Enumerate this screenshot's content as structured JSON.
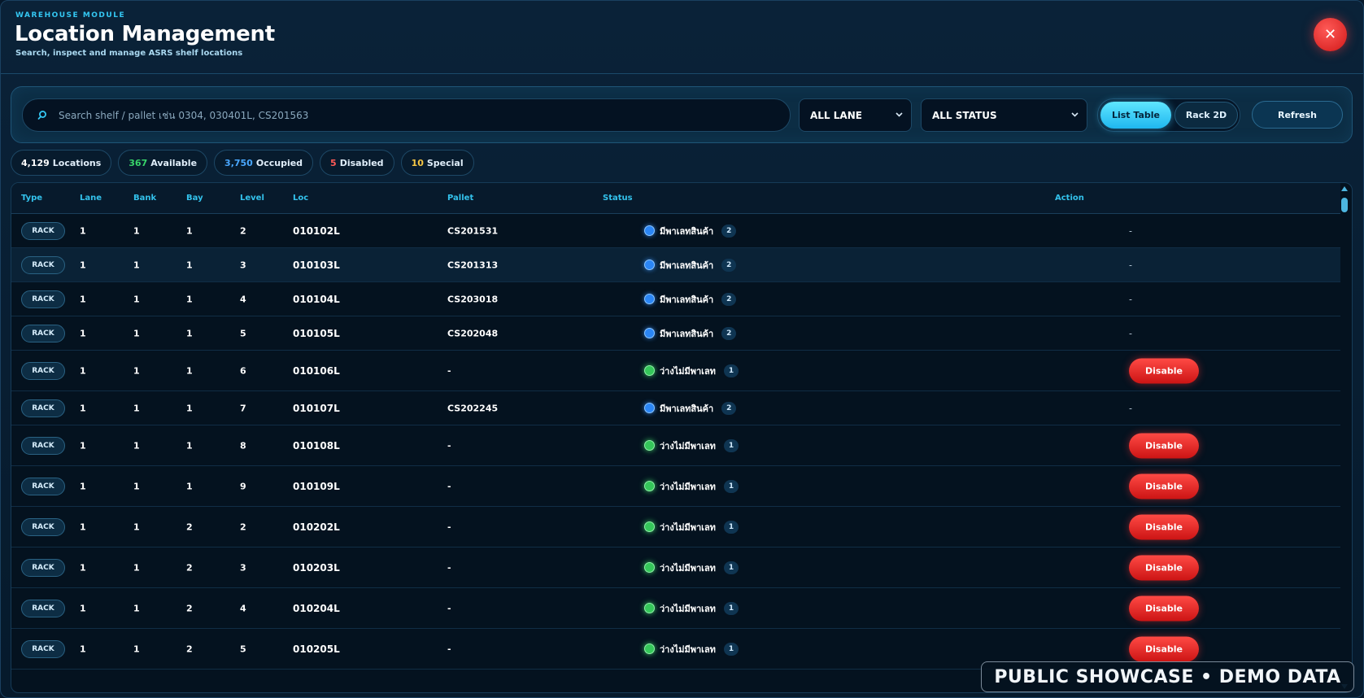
{
  "header": {
    "eyebrow": "WAREHOUSE MODULE",
    "title": "Location Management",
    "subtitle": "Search, inspect and manage ASRS shelf locations",
    "close_label": "✕"
  },
  "toolbar": {
    "search_placeholder": "Search shelf / pallet เช่น 0304, 030401L, CS201563",
    "search_value": "",
    "lane_select": "ALL LANE",
    "status_select": "ALL STATUS",
    "view_list_label": "List Table",
    "view_rack_label": "Rack 2D",
    "refresh_label": "Refresh"
  },
  "stats": [
    {
      "num": "4,129",
      "label": "Locations",
      "color": "#ffffff"
    },
    {
      "num": "367",
      "label": "Available",
      "color": "#38d46a"
    },
    {
      "num": "3,750",
      "label": "Occupied",
      "color": "#4aa8ff"
    },
    {
      "num": "5",
      "label": "Disabled",
      "color": "#ff5a57"
    },
    {
      "num": "10",
      "label": "Special",
      "color": "#f6c744"
    }
  ],
  "table": {
    "columns": [
      "Type",
      "Lane",
      "Bank",
      "Bay",
      "Level",
      "Loc",
      "Pallet",
      "Status",
      "Action"
    ],
    "rows": [
      {
        "type": "RACK",
        "lane": "1",
        "bank": "1",
        "bay": "1",
        "level": "2",
        "loc": "010102L",
        "pallet": "CS201531",
        "status": "มีพาเลทสินค้า",
        "status_kind": "occupied",
        "count": "2",
        "action": "-"
      },
      {
        "type": "RACK",
        "lane": "1",
        "bank": "1",
        "bay": "1",
        "level": "3",
        "loc": "010103L",
        "pallet": "CS201313",
        "status": "มีพาเลทสินค้า",
        "status_kind": "occupied",
        "count": "2",
        "action": "-"
      },
      {
        "type": "RACK",
        "lane": "1",
        "bank": "1",
        "bay": "1",
        "level": "4",
        "loc": "010104L",
        "pallet": "CS203018",
        "status": "มีพาเลทสินค้า",
        "status_kind": "occupied",
        "count": "2",
        "action": "-"
      },
      {
        "type": "RACK",
        "lane": "1",
        "bank": "1",
        "bay": "1",
        "level": "5",
        "loc": "010105L",
        "pallet": "CS202048",
        "status": "มีพาเลทสินค้า",
        "status_kind": "occupied",
        "count": "2",
        "action": "-"
      },
      {
        "type": "RACK",
        "lane": "1",
        "bank": "1",
        "bay": "1",
        "level": "6",
        "loc": "010106L",
        "pallet": "-",
        "status": "ว่างไม่มีพาเลท",
        "status_kind": "available",
        "count": "1",
        "action": "Disable"
      },
      {
        "type": "RACK",
        "lane": "1",
        "bank": "1",
        "bay": "1",
        "level": "7",
        "loc": "010107L",
        "pallet": "CS202245",
        "status": "มีพาเลทสินค้า",
        "status_kind": "occupied",
        "count": "2",
        "action": "-"
      },
      {
        "type": "RACK",
        "lane": "1",
        "bank": "1",
        "bay": "1",
        "level": "8",
        "loc": "010108L",
        "pallet": "-",
        "status": "ว่างไม่มีพาเลท",
        "status_kind": "available",
        "count": "1",
        "action": "Disable"
      },
      {
        "type": "RACK",
        "lane": "1",
        "bank": "1",
        "bay": "1",
        "level": "9",
        "loc": "010109L",
        "pallet": "-",
        "status": "ว่างไม่มีพาเลท",
        "status_kind": "available",
        "count": "1",
        "action": "Disable"
      },
      {
        "type": "RACK",
        "lane": "1",
        "bank": "1",
        "bay": "2",
        "level": "2",
        "loc": "010202L",
        "pallet": "-",
        "status": "ว่างไม่มีพาเลท",
        "status_kind": "available",
        "count": "1",
        "action": "Disable"
      },
      {
        "type": "RACK",
        "lane": "1",
        "bank": "1",
        "bay": "2",
        "level": "3",
        "loc": "010203L",
        "pallet": "-",
        "status": "ว่างไม่มีพาเลท",
        "status_kind": "available",
        "count": "1",
        "action": "Disable"
      },
      {
        "type": "RACK",
        "lane": "1",
        "bank": "1",
        "bay": "2",
        "level": "4",
        "loc": "010204L",
        "pallet": "-",
        "status": "ว่างไม่มีพาเลท",
        "status_kind": "available",
        "count": "1",
        "action": "Disable"
      },
      {
        "type": "RACK",
        "lane": "1",
        "bank": "1",
        "bay": "2",
        "level": "5",
        "loc": "010205L",
        "pallet": "-",
        "status": "ว่างไม่มีพาเลท",
        "status_kind": "available",
        "count": "1",
        "action": "Disable"
      }
    ]
  },
  "watermark": "PUBLIC SHOWCASE • DEMO DATA",
  "colors": {
    "accent": "#33c2ec",
    "occupied": "#2b86f5",
    "available": "#35c75a",
    "danger": "#e0201c"
  },
  "icons": {
    "search": "search-icon",
    "close": "close-icon",
    "chevron": "chevron-down-icon"
  }
}
